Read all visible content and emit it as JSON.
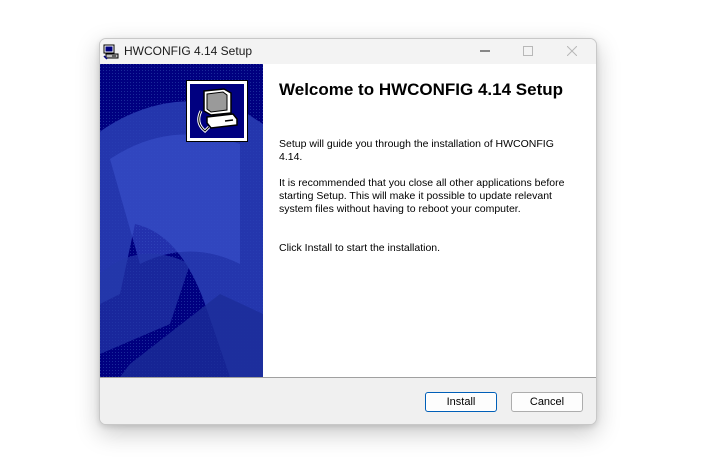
{
  "window": {
    "title": "HWCONFIG 4.14 Setup"
  },
  "content": {
    "heading": "Welcome to HWCONFIG 4.14 Setup",
    "paragraph1": "Setup will guide you through the installation of HWCONFIG 4.14.",
    "paragraph2": "It is recommended that you close all other applications before starting Setup. This will make it possible to update relevant system files without having to reboot your computer.",
    "paragraph3": "Click Install to start the installation."
  },
  "buttons": {
    "install": "Install",
    "cancel": "Cancel"
  },
  "icons": {
    "app": "installer-computer-icon",
    "banner_logo": "computer-setup-icon",
    "minimize": "minimize-icon",
    "maximize": "maximize-icon",
    "close": "close-icon"
  },
  "colors": {
    "banner": "#000080",
    "accent": "#005fb8"
  }
}
